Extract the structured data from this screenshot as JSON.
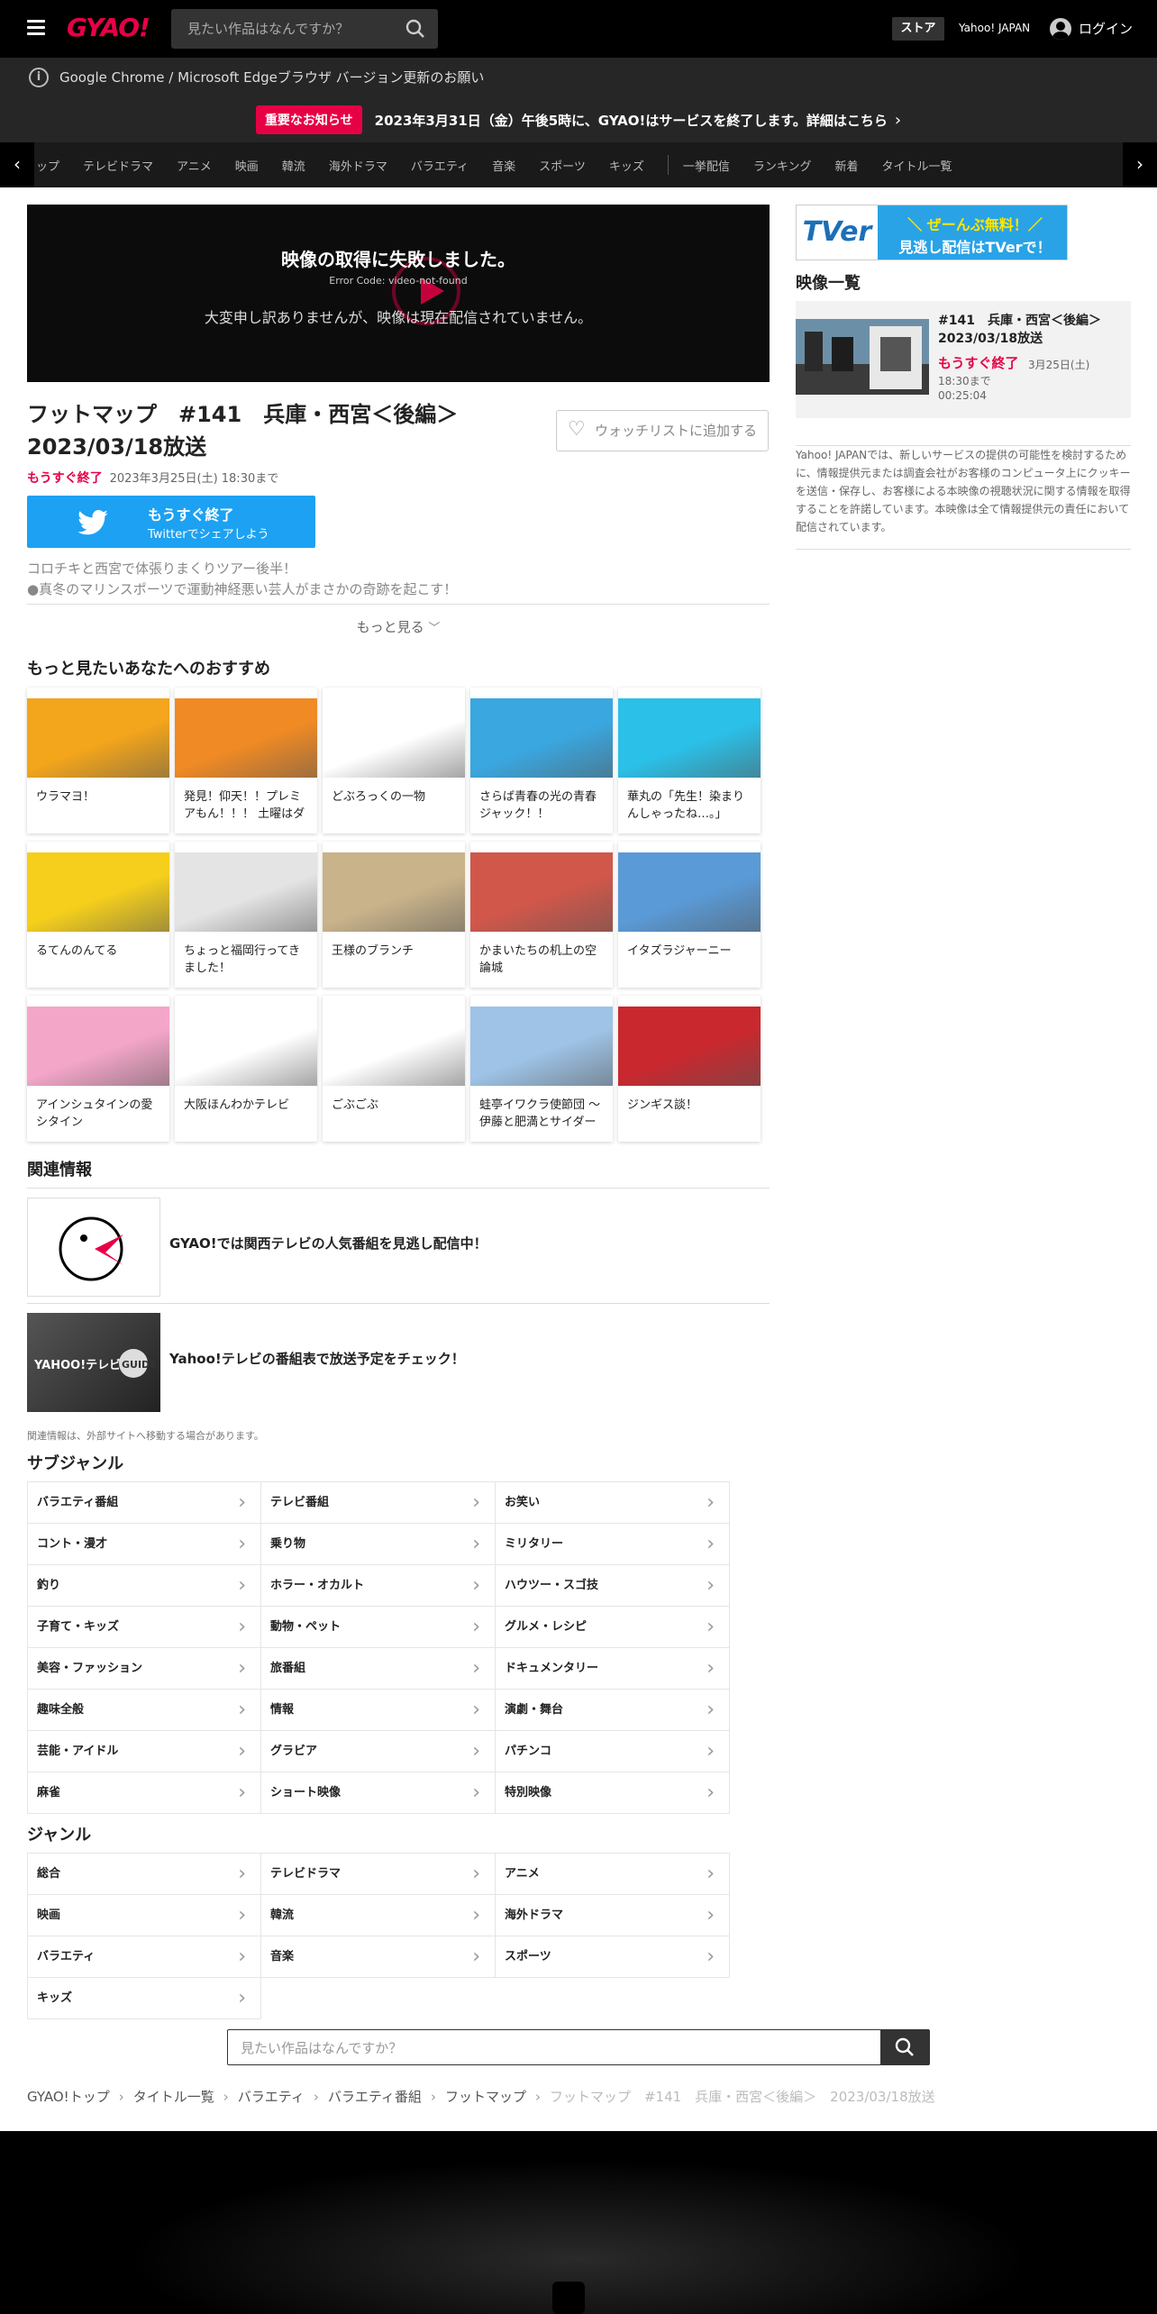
{
  "header": {
    "logo": "GYAO!",
    "search_placeholder": "見たい作品はなんですか？",
    "store": "ストア",
    "yahoo": "Yahoo! JAPAN",
    "login": "ログイン"
  },
  "notices": {
    "browser": "Google Chrome / Microsoft Edgeブラウザ バージョン更新のお願い",
    "badge": "重要なお知らせ",
    "end_service": "2023年3月31日（金）午後5時に、GYAO!はサービスを終了します。詳細はこちら"
  },
  "nav": [
    "ップ",
    "テレビドラマ",
    "アニメ",
    "映画",
    "韓流",
    "海外ドラマ",
    "バラエティ",
    "音楽",
    "スポーツ",
    "キッズ",
    "一挙配信",
    "ランキング",
    "新着",
    "タイトル一覧"
  ],
  "player": {
    "error_title": "映像の取得に失敗しました。",
    "error_code": "Error Code: video-not-found",
    "error_message": "大変申し訳ありませんが、映像は現在配信されていません。"
  },
  "video": {
    "title": "フットマップ　#141　兵庫・西宮＜後編＞　2023/03/18放送",
    "watchlist": "ウォッチリストに追加する",
    "ending": "もうすぐ終了",
    "until": "2023年3月25日(土) 18:30まで",
    "twitter_main": "もうすぐ終了",
    "twitter_sub": "Twitterでシェアしよう",
    "desc1": "コロチキと西宮で体張りまくりツアー後半！",
    "desc2": "●真冬のマリンスポーツで運動神経悪い芸人がまさかの奇跡を起こす！",
    "more": "もっと見る"
  },
  "recommend": {
    "heading": "もっと見たいあなたへのおすすめ",
    "items": [
      {
        "label": "ウラマヨ！",
        "color": "#f3a51b"
      },
      {
        "label": "発見！仰天！！プレミアもん！！！ 土曜はダ",
        "color": "#f08a24"
      },
      {
        "label": "どぶろっくの一物",
        "color": "#ffffff"
      },
      {
        "label": "さらば青春の光の青春ジャック！！",
        "color": "#3aa7e0"
      },
      {
        "label": "華丸の「先生！染まりんしゃったね…。」",
        "color": "#2bc0e8"
      },
      {
        "label": "るてんのんてる",
        "color": "#f5cf1b"
      },
      {
        "label": "ちょっと福岡行ってきました！",
        "color": "#e4e4e4"
      },
      {
        "label": "王様のブランチ",
        "color": "#c9b38a"
      },
      {
        "label": "かまいたちの机上の空論城",
        "color": "#d0574a"
      },
      {
        "label": "イタズラジャーニー",
        "color": "#5a9ad6"
      },
      {
        "label": "アインシュタインの愛シタイン",
        "color": "#f4a6c9"
      },
      {
        "label": "大阪ほんわかテレビ",
        "color": "#ffffff"
      },
      {
        "label": "ごぶごぶ",
        "color": "#ffffff"
      },
      {
        "label": "蛙亭イワクラ使節団 ～伊藤と肥満とサイダー",
        "color": "#9ec3e6"
      },
      {
        "label": "ジンギス談！",
        "color": "#c8282e"
      }
    ]
  },
  "related": {
    "heading": "関連情報",
    "items": [
      {
        "text": "GYAO!では関西テレビの人気番組を見逃し配信中！"
      },
      {
        "text": "Yahoo!テレビの番組表で放送予定をチェック！"
      }
    ],
    "note": "関連情報は、外部サイトへ移動する場合があります。"
  },
  "subgenre": {
    "heading": "サブジャンル",
    "items": [
      "バラエティ番組",
      "テレビ番組",
      "お笑い",
      "コント・漫才",
      "乗り物",
      "ミリタリー",
      "釣り",
      "ホラー・オカルト",
      "ハウツー・スゴ技",
      "子育て・キッズ",
      "動物・ペット",
      "グルメ・レシピ",
      "美容・ファッション",
      "旅番組",
      "ドキュメンタリー",
      "趣味全般",
      "情報",
      "演劇・舞台",
      "芸能・アイドル",
      "グラビア",
      "パチンコ",
      "麻雀",
      "ショート映像",
      "特別映像"
    ]
  },
  "genre": {
    "heading": "ジャンル",
    "items": [
      "総合",
      "テレビドラマ",
      "アニメ",
      "映画",
      "韓流",
      "海外ドラマ",
      "バラエティ",
      "音楽",
      "スポーツ",
      "キッズ"
    ]
  },
  "bottom_search_placeholder": "見たい作品はなんですか？",
  "breadcrumb": [
    "GYAO!トップ",
    "タイトル一覧",
    "バラエティ",
    "バラエティ番組",
    "フットマップ",
    "フットマップ　#141　兵庫・西宮＜後編＞　2023/03/18放送"
  ],
  "side": {
    "tver_logo": "TVer",
    "tver_line1": "＼ ぜーんぶ無料！／",
    "tver_line2": "見逃し配信はTVerで！",
    "list_heading": "映像一覧",
    "video_title": "#141　兵庫・西宮＜後編＞　2023/03/18放送",
    "video_ending": "もうすぐ終了",
    "video_until": "3月25日(土) 18:30まで",
    "video_duration": "00:25:04",
    "note": "Yahoo! JAPANでは、新しいサービスの提供の可能性を検討するために、情報提供元または調査会社がお客様のコンピュータ上にクッキーを送信・保存し、お客様による本映像の視聴状況に関する情報を取得することを許諾しています。本映像は全て情報提供元の責任において配信されています。"
  }
}
